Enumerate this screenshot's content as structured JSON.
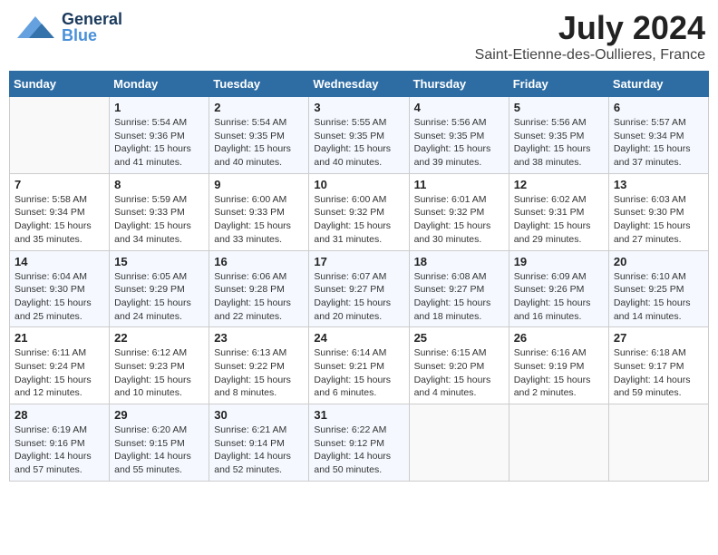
{
  "header": {
    "logo_general": "General",
    "logo_blue": "Blue",
    "title": "July 2024",
    "subtitle": "Saint-Etienne-des-Oullieres, France"
  },
  "calendar": {
    "days_of_week": [
      "Sunday",
      "Monday",
      "Tuesday",
      "Wednesday",
      "Thursday",
      "Friday",
      "Saturday"
    ],
    "weeks": [
      [
        {
          "day": "",
          "info": ""
        },
        {
          "day": "1",
          "info": "Sunrise: 5:54 AM\nSunset: 9:36 PM\nDaylight: 15 hours\nand 41 minutes."
        },
        {
          "day": "2",
          "info": "Sunrise: 5:54 AM\nSunset: 9:35 PM\nDaylight: 15 hours\nand 40 minutes."
        },
        {
          "day": "3",
          "info": "Sunrise: 5:55 AM\nSunset: 9:35 PM\nDaylight: 15 hours\nand 40 minutes."
        },
        {
          "day": "4",
          "info": "Sunrise: 5:56 AM\nSunset: 9:35 PM\nDaylight: 15 hours\nand 39 minutes."
        },
        {
          "day": "5",
          "info": "Sunrise: 5:56 AM\nSunset: 9:35 PM\nDaylight: 15 hours\nand 38 minutes."
        },
        {
          "day": "6",
          "info": "Sunrise: 5:57 AM\nSunset: 9:34 PM\nDaylight: 15 hours\nand 37 minutes."
        }
      ],
      [
        {
          "day": "7",
          "info": "Sunrise: 5:58 AM\nSunset: 9:34 PM\nDaylight: 15 hours\nand 35 minutes."
        },
        {
          "day": "8",
          "info": "Sunrise: 5:59 AM\nSunset: 9:33 PM\nDaylight: 15 hours\nand 34 minutes."
        },
        {
          "day": "9",
          "info": "Sunrise: 6:00 AM\nSunset: 9:33 PM\nDaylight: 15 hours\nand 33 minutes."
        },
        {
          "day": "10",
          "info": "Sunrise: 6:00 AM\nSunset: 9:32 PM\nDaylight: 15 hours\nand 31 minutes."
        },
        {
          "day": "11",
          "info": "Sunrise: 6:01 AM\nSunset: 9:32 PM\nDaylight: 15 hours\nand 30 minutes."
        },
        {
          "day": "12",
          "info": "Sunrise: 6:02 AM\nSunset: 9:31 PM\nDaylight: 15 hours\nand 29 minutes."
        },
        {
          "day": "13",
          "info": "Sunrise: 6:03 AM\nSunset: 9:30 PM\nDaylight: 15 hours\nand 27 minutes."
        }
      ],
      [
        {
          "day": "14",
          "info": "Sunrise: 6:04 AM\nSunset: 9:30 PM\nDaylight: 15 hours\nand 25 minutes."
        },
        {
          "day": "15",
          "info": "Sunrise: 6:05 AM\nSunset: 9:29 PM\nDaylight: 15 hours\nand 24 minutes."
        },
        {
          "day": "16",
          "info": "Sunrise: 6:06 AM\nSunset: 9:28 PM\nDaylight: 15 hours\nand 22 minutes."
        },
        {
          "day": "17",
          "info": "Sunrise: 6:07 AM\nSunset: 9:27 PM\nDaylight: 15 hours\nand 20 minutes."
        },
        {
          "day": "18",
          "info": "Sunrise: 6:08 AM\nSunset: 9:27 PM\nDaylight: 15 hours\nand 18 minutes."
        },
        {
          "day": "19",
          "info": "Sunrise: 6:09 AM\nSunset: 9:26 PM\nDaylight: 15 hours\nand 16 minutes."
        },
        {
          "day": "20",
          "info": "Sunrise: 6:10 AM\nSunset: 9:25 PM\nDaylight: 15 hours\nand 14 minutes."
        }
      ],
      [
        {
          "day": "21",
          "info": "Sunrise: 6:11 AM\nSunset: 9:24 PM\nDaylight: 15 hours\nand 12 minutes."
        },
        {
          "day": "22",
          "info": "Sunrise: 6:12 AM\nSunset: 9:23 PM\nDaylight: 15 hours\nand 10 minutes."
        },
        {
          "day": "23",
          "info": "Sunrise: 6:13 AM\nSunset: 9:22 PM\nDaylight: 15 hours\nand 8 minutes."
        },
        {
          "day": "24",
          "info": "Sunrise: 6:14 AM\nSunset: 9:21 PM\nDaylight: 15 hours\nand 6 minutes."
        },
        {
          "day": "25",
          "info": "Sunrise: 6:15 AM\nSunset: 9:20 PM\nDaylight: 15 hours\nand 4 minutes."
        },
        {
          "day": "26",
          "info": "Sunrise: 6:16 AM\nSunset: 9:19 PM\nDaylight: 15 hours\nand 2 minutes."
        },
        {
          "day": "27",
          "info": "Sunrise: 6:18 AM\nSunset: 9:17 PM\nDaylight: 14 hours\nand 59 minutes."
        }
      ],
      [
        {
          "day": "28",
          "info": "Sunrise: 6:19 AM\nSunset: 9:16 PM\nDaylight: 14 hours\nand 57 minutes."
        },
        {
          "day": "29",
          "info": "Sunrise: 6:20 AM\nSunset: 9:15 PM\nDaylight: 14 hours\nand 55 minutes."
        },
        {
          "day": "30",
          "info": "Sunrise: 6:21 AM\nSunset: 9:14 PM\nDaylight: 14 hours\nand 52 minutes."
        },
        {
          "day": "31",
          "info": "Sunrise: 6:22 AM\nSunset: 9:12 PM\nDaylight: 14 hours\nand 50 minutes."
        },
        {
          "day": "",
          "info": ""
        },
        {
          "day": "",
          "info": ""
        },
        {
          "day": "",
          "info": ""
        }
      ]
    ]
  }
}
